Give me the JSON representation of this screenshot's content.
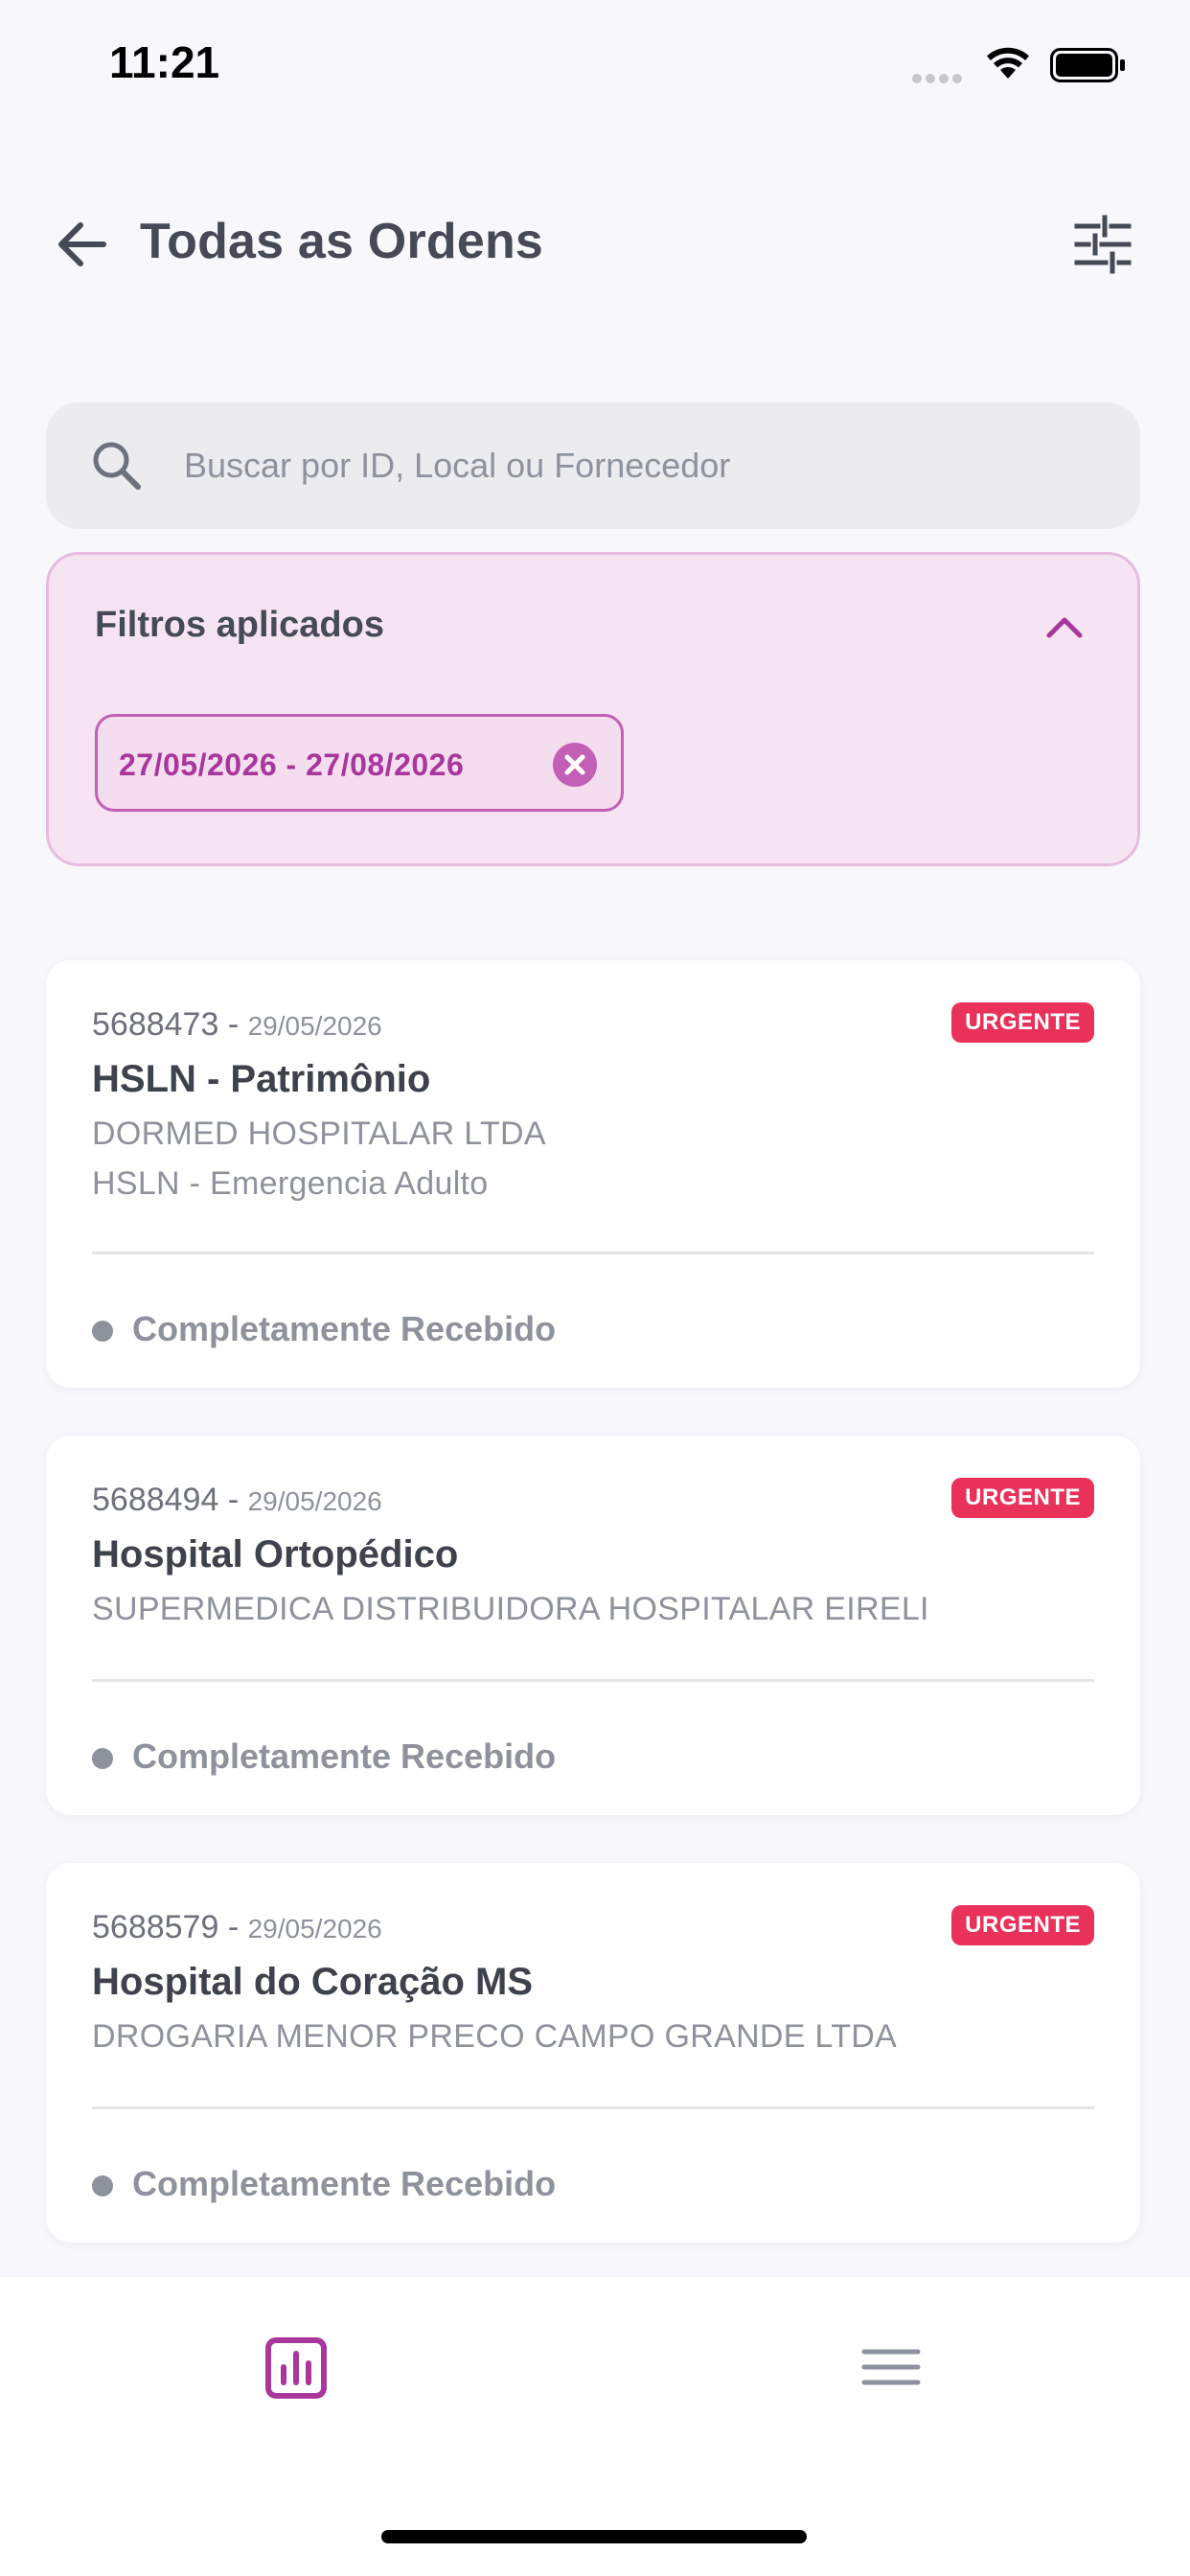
{
  "status_bar": {
    "time": "11:21"
  },
  "header": {
    "title": "Todas as Ordens"
  },
  "search": {
    "placeholder": "Buscar por ID, Local ou Fornecedor",
    "value": ""
  },
  "filters": {
    "title": "Filtros aplicados",
    "chips": [
      {
        "label": "27/05/2026 - 27/08/2026"
      }
    ]
  },
  "orders": [
    {
      "id": "5688473",
      "separator": " - ",
      "date": "29/05/2026",
      "badge": "URGENTE",
      "title": "HSLN - Patrimônio",
      "lines": [
        "DORMED HOSPITALAR LTDA",
        "HSLN - Emergencia Adulto"
      ],
      "status": "Completamente Recebido"
    },
    {
      "id": "5688494",
      "separator": " - ",
      "date": "29/05/2026",
      "badge": "URGENTE",
      "title": "Hospital Ortopédico",
      "lines": [
        "SUPERMEDICA DISTRIBUIDORA HOSPITALAR EIRELI"
      ],
      "status": "Completamente Recebido"
    },
    {
      "id": "5688579",
      "separator": " - ",
      "date": "29/05/2026",
      "badge": "URGENTE",
      "title": "Hospital do Coração MS",
      "lines": [
        "DROGARIA MENOR PRECO CAMPO GRANDE LTDA"
      ],
      "status": "Completamente Recebido"
    }
  ],
  "icons": {
    "back": "arrow-left-icon",
    "filter": "sliders-icon",
    "search": "search-icon",
    "collapse": "chevron-up-icon",
    "chip_remove": "close-circle-icon",
    "nav_reports": "bar-chart-icon",
    "nav_menu": "hamburger-menu-icon"
  },
  "colors": {
    "accent": "#a9369c",
    "urgent": "#e8325a",
    "background": "#f8f8fc",
    "status_gray": "#8e929c"
  }
}
